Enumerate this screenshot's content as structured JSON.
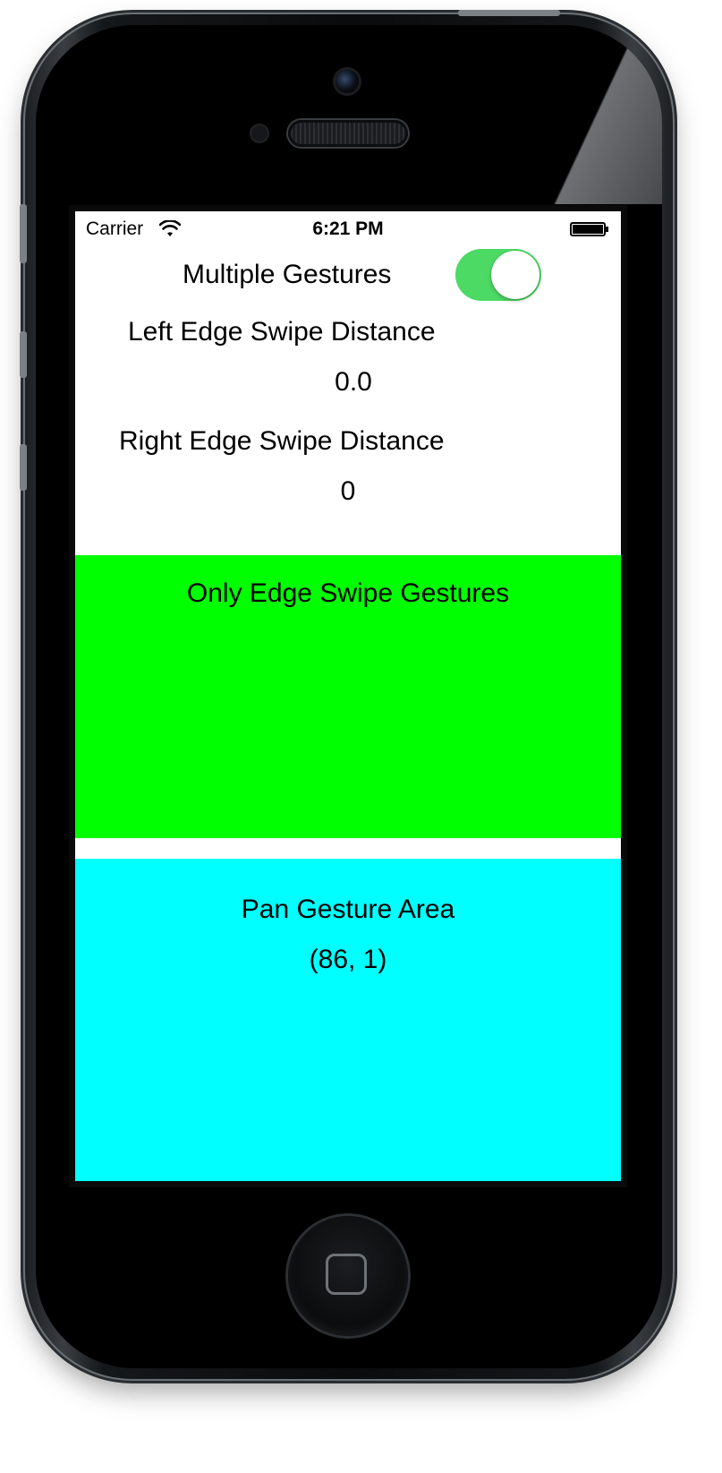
{
  "status_bar": {
    "carrier": "Carrier",
    "time": "6:21 PM",
    "wifi_icon": "wifi-icon",
    "battery_icon": "battery-full-icon"
  },
  "controls": {
    "multiple_gestures_label": "Multiple Gestures",
    "multiple_gestures_toggle_on": true,
    "toggle_color": "#4cd964"
  },
  "left_edge": {
    "label": "Left Edge Swipe Distance",
    "value": "0.0"
  },
  "right_edge": {
    "label": "Right Edge Swipe Distance",
    "value": "0"
  },
  "edge_area": {
    "label": "Only Edge Swipe Gestures",
    "color": "#00ff00"
  },
  "pan_area": {
    "label": "Pan Gesture Area",
    "coordinates": "(86, 1)",
    "color": "#00ffff"
  }
}
